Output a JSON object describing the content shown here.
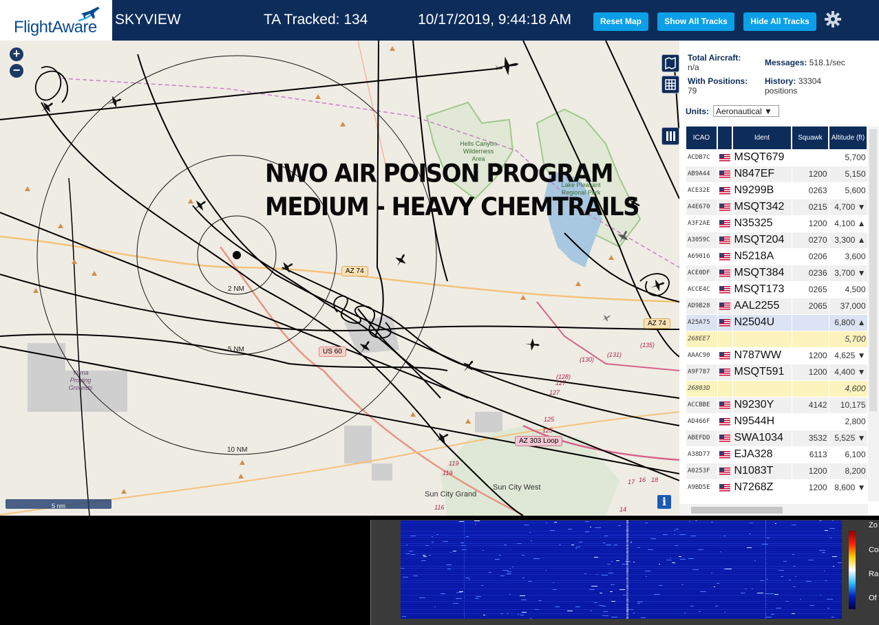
{
  "header": {
    "brand": "FlightAware",
    "app_title": "SKYVIEW",
    "ta_tracked": "TA Tracked: 134",
    "clock": "10/17/2019, 9:44:18 AM",
    "buttons": {
      "reset_map": "Reset Map",
      "show_all_tracks": "Show All Tracks",
      "hide_all_tracks": "Hide All Tracks"
    },
    "settings_icon": "gear-icon"
  },
  "map": {
    "zoom_in": "+",
    "zoom_out": "−",
    "headline_line1": "NWO AIR POISON PROGRAM",
    "headline_line2": "MEDIUM - HEAVY CHEMTRAILS",
    "range_rings": [
      "2 NM",
      "5 NM",
      "10 NM"
    ],
    "road_labels": {
      "az74_a": "AZ 74",
      "az74_b": "AZ 74",
      "us60": "US 60",
      "az303": "AZ 303 Loop"
    },
    "places": {
      "hells_canyon": "Hells Canyon Wilderness Area",
      "lake_pleasant": "Lake Pleasant Regional Park",
      "yuma_grounds": "Yuma Proving Grounds",
      "sun_city_grand": "Sun City Grand",
      "sun_city_west": "Sun City West"
    },
    "route_numbers": [
      "(135)",
      "(131)",
      "(130)",
      "(128)",
      "127",
      "127",
      "125",
      "125",
      "119",
      "119",
      "116",
      "17",
      "16",
      "18",
      "14"
    ],
    "scale_label": "5 nm",
    "info_btn": "i",
    "tool_icons": [
      "map-layers-icon",
      "grid-icon",
      "columns-icon"
    ]
  },
  "sidebar": {
    "total_aircraft_label": "Total Aircraft:",
    "total_aircraft_value": "n/a",
    "with_positions_label": "With Positions:",
    "with_positions_value": "79",
    "messages_label": "Messages:",
    "messages_value": "518.1/sec",
    "history_label": "History:",
    "history_value": "33304 positions",
    "units_label": "Units:",
    "units_value": "Aeronautical ▼",
    "table": {
      "headers": [
        "ICAO",
        "",
        "Ident",
        "Squawk",
        "Altitude (ft)"
      ],
      "rows": [
        {
          "icao": "ACDB7C",
          "flag": true,
          "ident": "MSQT679",
          "squawk": "",
          "alt": "5,700"
        },
        {
          "icao": "AB9A44",
          "flag": true,
          "ident": "N847EF",
          "squawk": "1200",
          "alt": "5,150"
        },
        {
          "icao": "ACE32E",
          "flag": true,
          "ident": "N9299B",
          "squawk": "0263",
          "alt": "5,600"
        },
        {
          "icao": "A4E670",
          "flag": true,
          "ident": "MSQT342",
          "squawk": "0215",
          "alt": "4,700 ▼"
        },
        {
          "icao": "A3F2AE",
          "flag": true,
          "ident": "N35325",
          "squawk": "1200",
          "alt": "4,100 ▲"
        },
        {
          "icao": "A3059C",
          "flag": true,
          "ident": "MSQT204",
          "squawk": "0270",
          "alt": "3,300 ▲"
        },
        {
          "icao": "A69016",
          "flag": true,
          "ident": "N5218A",
          "squawk": "0206",
          "alt": "3,600"
        },
        {
          "icao": "ACE0DF",
          "flag": true,
          "ident": "MSQT384",
          "squawk": "0236",
          "alt": "3,700 ▼"
        },
        {
          "icao": "ACCE4C",
          "flag": true,
          "ident": "MSQT173",
          "squawk": "0265",
          "alt": "4,500"
        },
        {
          "icao": "AD9B28",
          "flag": true,
          "ident": "AAL2255",
          "squawk": "2065",
          "alt": "37,000"
        },
        {
          "icao": "A25A75",
          "flag": true,
          "ident": "N2504U",
          "squawk": "",
          "alt": "6,800 ▲",
          "style": "sel"
        },
        {
          "icao": "268EE7",
          "flag": false,
          "ident": "",
          "squawk": "",
          "alt": "5,700",
          "style": "mlat"
        },
        {
          "icao": "AAAC90",
          "flag": true,
          "ident": "N787WW",
          "squawk": "1200",
          "alt": "4,625 ▼"
        },
        {
          "icao": "A9F787",
          "flag": true,
          "ident": "MSQT591",
          "squawk": "1200",
          "alt": "4,400 ▼"
        },
        {
          "icao": "26803D",
          "flag": false,
          "ident": "",
          "squawk": "",
          "alt": "4,600",
          "style": "mlat"
        },
        {
          "icao": "ACCBBE",
          "flag": true,
          "ident": "N9230Y",
          "squawk": "4142",
          "alt": "10,175"
        },
        {
          "icao": "AD466F",
          "flag": true,
          "ident": "N9544H",
          "squawk": "",
          "alt": "2,800"
        },
        {
          "icao": "ABEFDD",
          "flag": true,
          "ident": "SWA1034",
          "squawk": "3532",
          "alt": "5,525 ▼"
        },
        {
          "icao": "A38D77",
          "flag": true,
          "ident": "EJA328",
          "squawk": "6113",
          "alt": "6,100"
        },
        {
          "icao": "A0253F",
          "flag": true,
          "ident": "N1083T",
          "squawk": "1200",
          "alt": "8,200"
        },
        {
          "icao": "A9BD5E",
          "flag": true,
          "ident": "N7268Z",
          "squawk": "1200",
          "alt": "8,600 ▼"
        }
      ]
    }
  },
  "spectrum": {
    "side_labels": [
      "Zo",
      "Con",
      "Ra",
      "Of"
    ]
  },
  "colors": {
    "header_bg": "#0d2c5a",
    "button_bg": "#0b9fe8",
    "map_bg": "#efece4",
    "selected_row": "#dce3f4",
    "mlat_row": "#fdf3bd"
  }
}
